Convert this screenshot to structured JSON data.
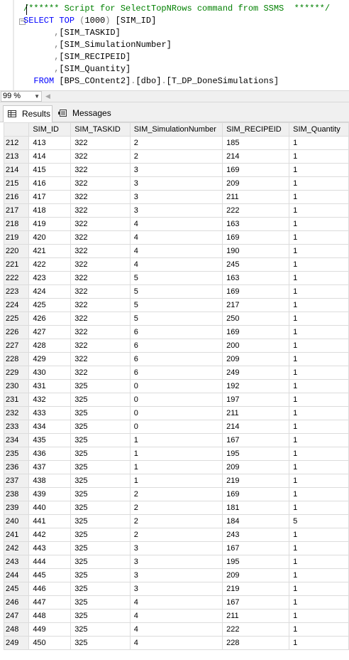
{
  "editor": {
    "lines": [
      [
        {
          "t": "/****** Script for SelectTopNRows command from SSMS  ******/",
          "c": "comment"
        }
      ],
      [
        {
          "t": "SELECT",
          "c": "kw"
        },
        {
          "t": " ",
          "c": "plain"
        },
        {
          "t": "TOP",
          "c": "kw"
        },
        {
          "t": " (",
          "c": "gray"
        },
        {
          "t": "1000",
          "c": "plain"
        },
        {
          "t": ") ",
          "c": "gray"
        },
        {
          "t": "[SIM_ID]",
          "c": "plain"
        }
      ],
      [
        {
          "t": "      ,",
          "c": "gray"
        },
        {
          "t": "[SIM_TASKID]",
          "c": "plain"
        }
      ],
      [
        {
          "t": "      ,",
          "c": "gray"
        },
        {
          "t": "[SIM_SimulationNumber]",
          "c": "plain"
        }
      ],
      [
        {
          "t": "      ,",
          "c": "gray"
        },
        {
          "t": "[SIM_RECIPEID]",
          "c": "plain"
        }
      ],
      [
        {
          "t": "      ,",
          "c": "gray"
        },
        {
          "t": "[SIM_Quantity]",
          "c": "plain"
        }
      ],
      [
        {
          "t": "  FROM",
          "c": "kw"
        },
        {
          "t": " ",
          "c": "plain"
        },
        {
          "t": "[BPS_COntent2]",
          "c": "plain"
        },
        {
          "t": ".",
          "c": "gray"
        },
        {
          "t": "[dbo]",
          "c": "plain"
        },
        {
          "t": ".",
          "c": "gray"
        },
        {
          "t": "[T_DP_DoneSimulations]",
          "c": "plain"
        }
      ]
    ]
  },
  "zoom": {
    "value": "99 %"
  },
  "tabs": {
    "results": "Results",
    "messages": "Messages"
  },
  "grid": {
    "columns": [
      "SIM_ID",
      "SIM_TASKID",
      "SIM_SimulationNumber",
      "SIM_RECIPEID",
      "SIM_Quantity"
    ],
    "rows": [
      [
        "212",
        "413",
        "322",
        "2",
        "185",
        "1"
      ],
      [
        "213",
        "414",
        "322",
        "2",
        "214",
        "1"
      ],
      [
        "214",
        "415",
        "322",
        "3",
        "169",
        "1"
      ],
      [
        "215",
        "416",
        "322",
        "3",
        "209",
        "1"
      ],
      [
        "216",
        "417",
        "322",
        "3",
        "211",
        "1"
      ],
      [
        "217",
        "418",
        "322",
        "3",
        "222",
        "1"
      ],
      [
        "218",
        "419",
        "322",
        "4",
        "163",
        "1"
      ],
      [
        "219",
        "420",
        "322",
        "4",
        "169",
        "1"
      ],
      [
        "220",
        "421",
        "322",
        "4",
        "190",
        "1"
      ],
      [
        "221",
        "422",
        "322",
        "4",
        "245",
        "1"
      ],
      [
        "222",
        "423",
        "322",
        "5",
        "163",
        "1"
      ],
      [
        "223",
        "424",
        "322",
        "5",
        "169",
        "1"
      ],
      [
        "224",
        "425",
        "322",
        "5",
        "217",
        "1"
      ],
      [
        "225",
        "426",
        "322",
        "5",
        "250",
        "1"
      ],
      [
        "226",
        "427",
        "322",
        "6",
        "169",
        "1"
      ],
      [
        "227",
        "428",
        "322",
        "6",
        "200",
        "1"
      ],
      [
        "228",
        "429",
        "322",
        "6",
        "209",
        "1"
      ],
      [
        "229",
        "430",
        "322",
        "6",
        "249",
        "1"
      ],
      [
        "230",
        "431",
        "325",
        "0",
        "192",
        "1"
      ],
      [
        "231",
        "432",
        "325",
        "0",
        "197",
        "1"
      ],
      [
        "232",
        "433",
        "325",
        "0",
        "211",
        "1"
      ],
      [
        "233",
        "434",
        "325",
        "0",
        "214",
        "1"
      ],
      [
        "234",
        "435",
        "325",
        "1",
        "167",
        "1"
      ],
      [
        "235",
        "436",
        "325",
        "1",
        "195",
        "1"
      ],
      [
        "236",
        "437",
        "325",
        "1",
        "209",
        "1"
      ],
      [
        "237",
        "438",
        "325",
        "1",
        "219",
        "1"
      ],
      [
        "238",
        "439",
        "325",
        "2",
        "169",
        "1"
      ],
      [
        "239",
        "440",
        "325",
        "2",
        "181",
        "1"
      ],
      [
        "240",
        "441",
        "325",
        "2",
        "184",
        "5"
      ],
      [
        "241",
        "442",
        "325",
        "2",
        "243",
        "1"
      ],
      [
        "242",
        "443",
        "325",
        "3",
        "167",
        "1"
      ],
      [
        "243",
        "444",
        "325",
        "3",
        "195",
        "1"
      ],
      [
        "244",
        "445",
        "325",
        "3",
        "209",
        "1"
      ],
      [
        "245",
        "446",
        "325",
        "3",
        "219",
        "1"
      ],
      [
        "246",
        "447",
        "325",
        "4",
        "167",
        "1"
      ],
      [
        "247",
        "448",
        "325",
        "4",
        "211",
        "1"
      ],
      [
        "248",
        "449",
        "325",
        "4",
        "222",
        "1"
      ],
      [
        "249",
        "450",
        "325",
        "4",
        "228",
        "1"
      ]
    ]
  }
}
